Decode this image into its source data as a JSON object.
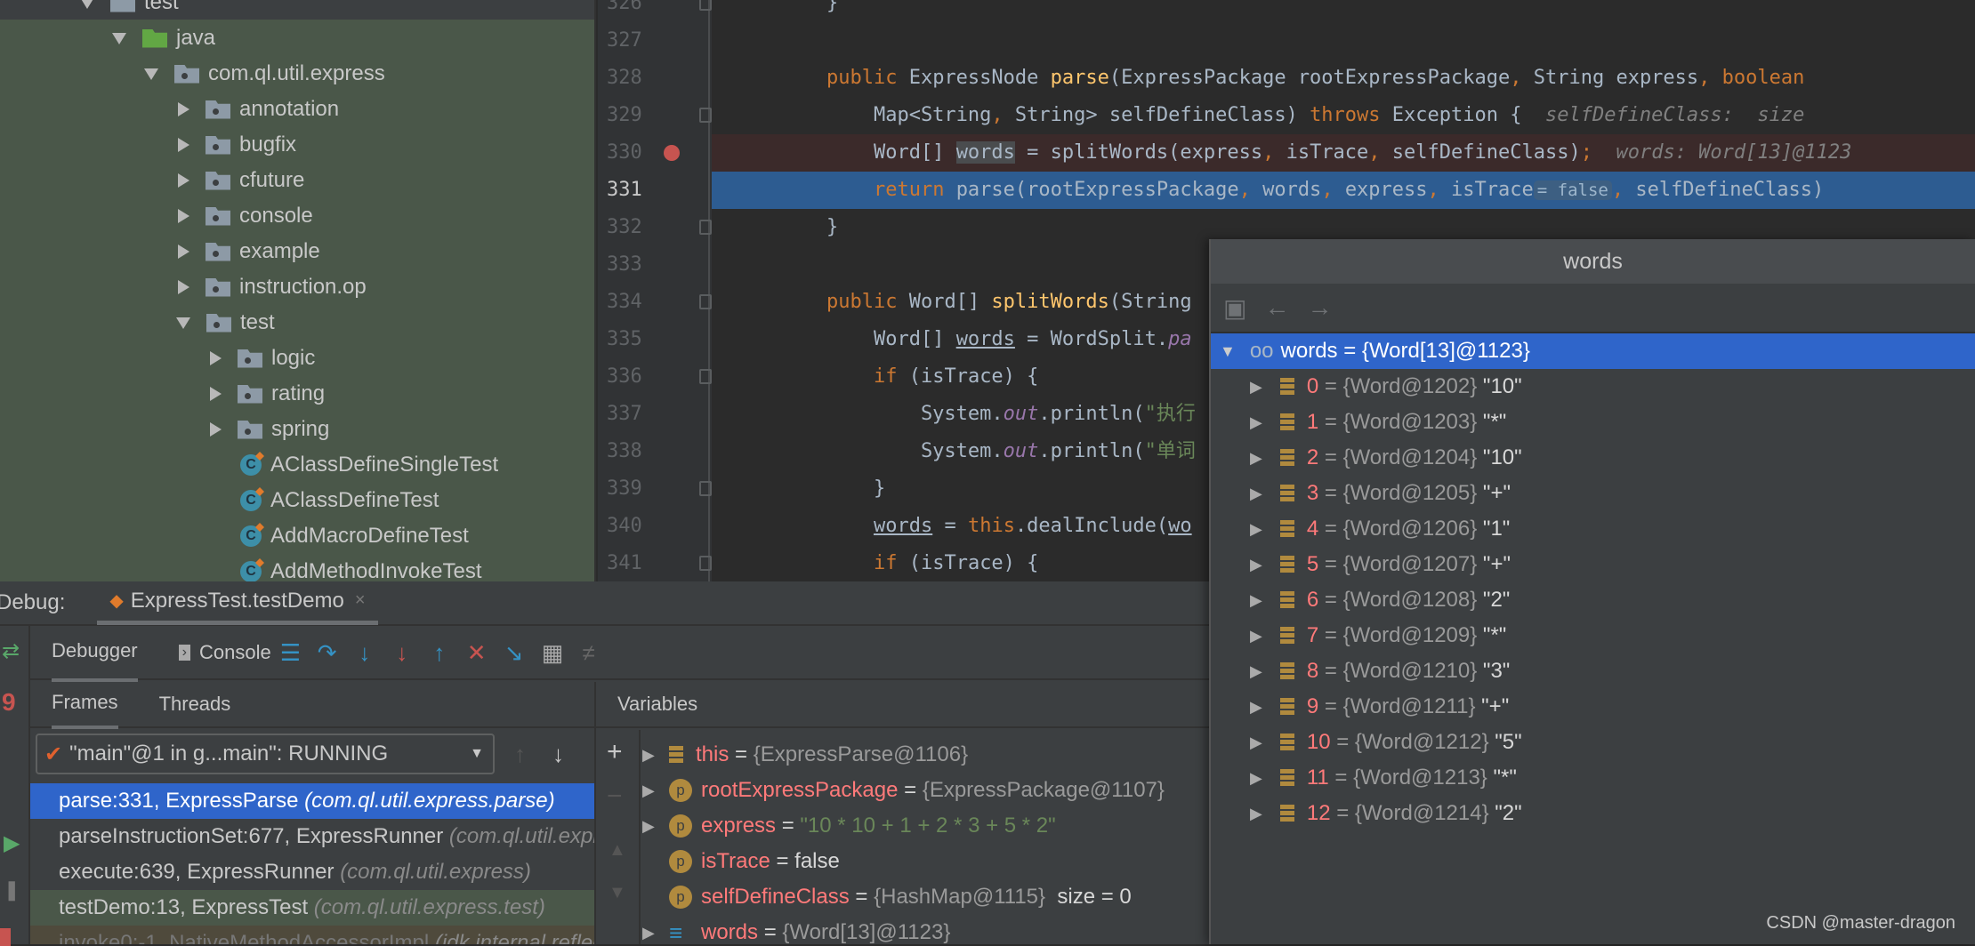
{
  "project_tree": {
    "items": [
      {
        "label": "test",
        "depth": 0,
        "expanded": true,
        "icon": "folder"
      },
      {
        "label": "java",
        "depth": 1,
        "expanded": true,
        "icon": "source-folder"
      },
      {
        "label": "com.ql.util.express",
        "depth": 2,
        "expanded": true,
        "icon": "package"
      },
      {
        "label": "annotation",
        "depth": 3,
        "expanded": false,
        "icon": "package"
      },
      {
        "label": "bugfix",
        "depth": 3,
        "expanded": false,
        "icon": "package"
      },
      {
        "label": "cfuture",
        "depth": 3,
        "expanded": false,
        "icon": "package"
      },
      {
        "label": "console",
        "depth": 3,
        "expanded": false,
        "icon": "package"
      },
      {
        "label": "example",
        "depth": 3,
        "expanded": false,
        "icon": "package"
      },
      {
        "label": "instruction.op",
        "depth": 3,
        "expanded": false,
        "icon": "package"
      },
      {
        "label": "test",
        "depth": 3,
        "expanded": true,
        "icon": "package"
      },
      {
        "label": "logic",
        "depth": 4,
        "expanded": false,
        "icon": "package"
      },
      {
        "label": "rating",
        "depth": 4,
        "expanded": false,
        "icon": "package"
      },
      {
        "label": "spring",
        "depth": 4,
        "expanded": false,
        "icon": "package"
      },
      {
        "label": "AClassDefineSingleTest",
        "depth": 4,
        "icon": "class"
      },
      {
        "label": "AClassDefineTest",
        "depth": 4,
        "icon": "class"
      },
      {
        "label": "AddMacroDefineTest",
        "depth": 4,
        "icon": "class"
      },
      {
        "label": "AddMethodInvokeTest",
        "depth": 4,
        "icon": "class"
      }
    ]
  },
  "editor": {
    "lines": [
      {
        "n": "326",
        "fold": true,
        "tokens": [
          [
            "    }",
            ""
          ]
        ]
      },
      {
        "n": "327",
        "tokens": []
      },
      {
        "n": "328",
        "tokens": [
          [
            "    ",
            ""
          ],
          [
            "public ",
            "k"
          ],
          [
            "ExpressNode ",
            ""
          ],
          [
            "parse",
            "f"
          ],
          [
            "(ExpressPackage rootExpressPackage",
            ""
          ],
          [
            ", ",
            "k"
          ],
          [
            "String express",
            ""
          ],
          [
            ", ",
            "k"
          ],
          [
            "boolean",
            "k"
          ]
        ]
      },
      {
        "n": "329",
        "fold": true,
        "tokens": [
          [
            "        Map<String",
            ""
          ],
          [
            ", ",
            "k"
          ],
          [
            "String> selfDefineClass) ",
            ""
          ],
          [
            "throws ",
            "k"
          ],
          [
            "Exception {  ",
            ""
          ],
          [
            "selfDefineClass:  size",
            "h"
          ]
        ]
      },
      {
        "n": "330",
        "breakpoint": true,
        "state": "breakpoint",
        "tokens": [
          [
            "        Word[] ",
            ""
          ],
          [
            "words",
            "hl"
          ],
          [
            " = splitWords(express",
            ""
          ],
          [
            ", ",
            "k"
          ],
          [
            "isTrace",
            ""
          ],
          [
            ", ",
            "k"
          ],
          [
            "selfDefineClass)",
            ""
          ],
          [
            ";  ",
            "k"
          ],
          [
            "words: Word[13]@1123",
            "h"
          ]
        ]
      },
      {
        "n": "331",
        "state": "current",
        "tokens": [
          [
            "        ",
            ""
          ],
          [
            "return ",
            "k"
          ],
          [
            "parse(rootExpressPackage",
            ""
          ],
          [
            ", ",
            "k"
          ],
          [
            "words",
            ""
          ],
          [
            ", ",
            "k"
          ],
          [
            "express",
            ""
          ],
          [
            ", ",
            "k"
          ],
          [
            "isTrace",
            ""
          ],
          [
            "= false",
            "inl"
          ],
          [
            ", ",
            "k"
          ],
          [
            "selfDefineClass)",
            ""
          ]
        ]
      },
      {
        "n": "332",
        "fold": true,
        "tokens": [
          [
            "    }",
            ""
          ]
        ]
      },
      {
        "n": "333",
        "tokens": []
      },
      {
        "n": "334",
        "fold": true,
        "tokens": [
          [
            "    ",
            ""
          ],
          [
            "public ",
            "k"
          ],
          [
            "Word[] ",
            ""
          ],
          [
            "splitWords",
            "f"
          ],
          [
            "(String",
            ""
          ]
        ]
      },
      {
        "n": "335",
        "tokens": [
          [
            "        Word[] ",
            ""
          ],
          [
            "words",
            "u"
          ],
          [
            " = WordSplit.",
            ""
          ],
          [
            "pa",
            "p"
          ]
        ]
      },
      {
        "n": "336",
        "fold": true,
        "tokens": [
          [
            "        ",
            ""
          ],
          [
            "if ",
            "k"
          ],
          [
            "(isTrace) {",
            ""
          ]
        ]
      },
      {
        "n": "337",
        "tokens": [
          [
            "            System.",
            ""
          ],
          [
            "out",
            "p"
          ],
          [
            ".println(",
            ""
          ],
          [
            "\"执行",
            "s"
          ]
        ]
      },
      {
        "n": "338",
        "tokens": [
          [
            "            System.",
            ""
          ],
          [
            "out",
            "p"
          ],
          [
            ".println(",
            ""
          ],
          [
            "\"单词",
            "s"
          ]
        ]
      },
      {
        "n": "339",
        "fold": true,
        "tokens": [
          [
            "        }",
            ""
          ]
        ]
      },
      {
        "n": "340",
        "tokens": [
          [
            "        ",
            ""
          ],
          [
            "words",
            "u"
          ],
          [
            " = ",
            ""
          ],
          [
            "this",
            "k"
          ],
          [
            ".dealInclude(",
            ""
          ],
          [
            "wo",
            "u"
          ]
        ]
      },
      {
        "n": "341",
        "fold": true,
        "tokens": [
          [
            "        ",
            ""
          ],
          [
            "if ",
            "k"
          ],
          [
            "(isTrace) {",
            ""
          ]
        ]
      }
    ]
  },
  "popup": {
    "title": "words",
    "root": {
      "name": "words",
      "value": "{Word[13]@1123}"
    },
    "items": [
      {
        "i": "0",
        "ref": "{Word@1202}",
        "val": "\"10\""
      },
      {
        "i": "1",
        "ref": "{Word@1203}",
        "val": "\"*\""
      },
      {
        "i": "2",
        "ref": "{Word@1204}",
        "val": "\"10\""
      },
      {
        "i": "3",
        "ref": "{Word@1205}",
        "val": "\"+\""
      },
      {
        "i": "4",
        "ref": "{Word@1206}",
        "val": "\"1\""
      },
      {
        "i": "5",
        "ref": "{Word@1207}",
        "val": "\"+\""
      },
      {
        "i": "6",
        "ref": "{Word@1208}",
        "val": "\"2\""
      },
      {
        "i": "7",
        "ref": "{Word@1209}",
        "val": "\"*\""
      },
      {
        "i": "8",
        "ref": "{Word@1210}",
        "val": "\"3\""
      },
      {
        "i": "9",
        "ref": "{Word@1211}",
        "val": "\"+\""
      },
      {
        "i": "10",
        "ref": "{Word@1212}",
        "val": "\"5\""
      },
      {
        "i": "11",
        "ref": "{Word@1213}",
        "val": "\"*\""
      },
      {
        "i": "12",
        "ref": "{Word@1214}",
        "val": "\"2\""
      }
    ]
  },
  "debug": {
    "label": "Debug:",
    "session_tab": "ExpressTest.testDemo",
    "tabs": {
      "debugger": "Debugger",
      "console": "Console"
    },
    "frames_tabs": {
      "frames": "Frames",
      "threads": "Threads"
    },
    "thread_select": "\"main\"@1 in g...main\": RUNNING",
    "variables_title": "Variables",
    "frames": [
      {
        "method": "parseInstructionSet:677, ExpressRunner",
        "pkg": "(com.ql.util.express.ExpressRunner)",
        "state": "normal"
      },
      {
        "method": "execute:639, ExpressRunner",
        "pkg": "(com.ql.util.express)",
        "state": "normal"
      },
      {
        "method": "testDemo:13, ExpressTest",
        "pkg": "(com.ql.util.express.test)",
        "state": "test"
      },
      {
        "method": "invoke0:-1, NativeMethodAccessorImpl",
        "pkg": "(jdk.internal.reflect)",
        "state": "library"
      }
    ],
    "selected_frame": {
      "method": "parse:331, ExpressParse",
      "pkg": "(com.ql.util.express.parse)"
    },
    "variables": [
      {
        "name": "this",
        "value": "{ExpressParse@1106}",
        "icon": "field",
        "expandable": true
      },
      {
        "name": "rootExpressPackage",
        "value": "{ExpressPackage@1107}",
        "icon": "param",
        "expandable": true
      },
      {
        "name": "express",
        "value": "\"10 * 10 + 1 + 2 * 3 + 5 * 2\"",
        "icon": "param",
        "expandable": true,
        "string": true
      },
      {
        "name": "isTrace",
        "value": "false",
        "icon": "param",
        "expandable": false,
        "plain": true
      },
      {
        "name": "selfDefineClass",
        "value": "{HashMap@1115}",
        "extra": "size = 0",
        "icon": "param",
        "expandable": false
      },
      {
        "name": "words",
        "value": "{Word[13]@1123}",
        "icon": "array",
        "expandable": true
      }
    ]
  },
  "watermark": "CSDN @master-dragon",
  "colors": {
    "accent": "#2f65ca",
    "current_line": "#2d5c91",
    "breakpoint_line": "#3b2a2a",
    "breakpoint": "#c75450"
  }
}
